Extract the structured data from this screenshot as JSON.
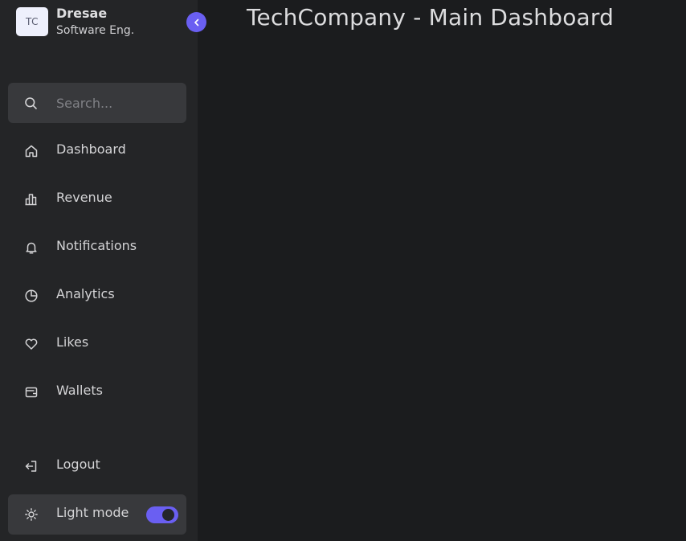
{
  "profile": {
    "avatar_initials": "TC",
    "name": "Dresae",
    "role": "Software Eng."
  },
  "search": {
    "placeholder": "Search...",
    "value": ""
  },
  "nav": {
    "items": [
      {
        "label": "Dashboard",
        "icon": "home-icon"
      },
      {
        "label": "Revenue",
        "icon": "bar-chart-icon"
      },
      {
        "label": "Notifications",
        "icon": "bell-icon"
      },
      {
        "label": "Analytics",
        "icon": "pie-chart-icon"
      },
      {
        "label": "Likes",
        "icon": "heart-icon"
      },
      {
        "label": "Wallets",
        "icon": "wallet-icon"
      }
    ],
    "logout_label": "Logout"
  },
  "mode": {
    "label": "Light mode",
    "toggle_on": true
  },
  "colors": {
    "accent": "#6a5ff2",
    "sidebar_bg": "#242527",
    "page_bg": "#1b1c1e",
    "search_bg": "#38393c"
  },
  "page": {
    "title": "TechCompany - Main Dashboard"
  }
}
